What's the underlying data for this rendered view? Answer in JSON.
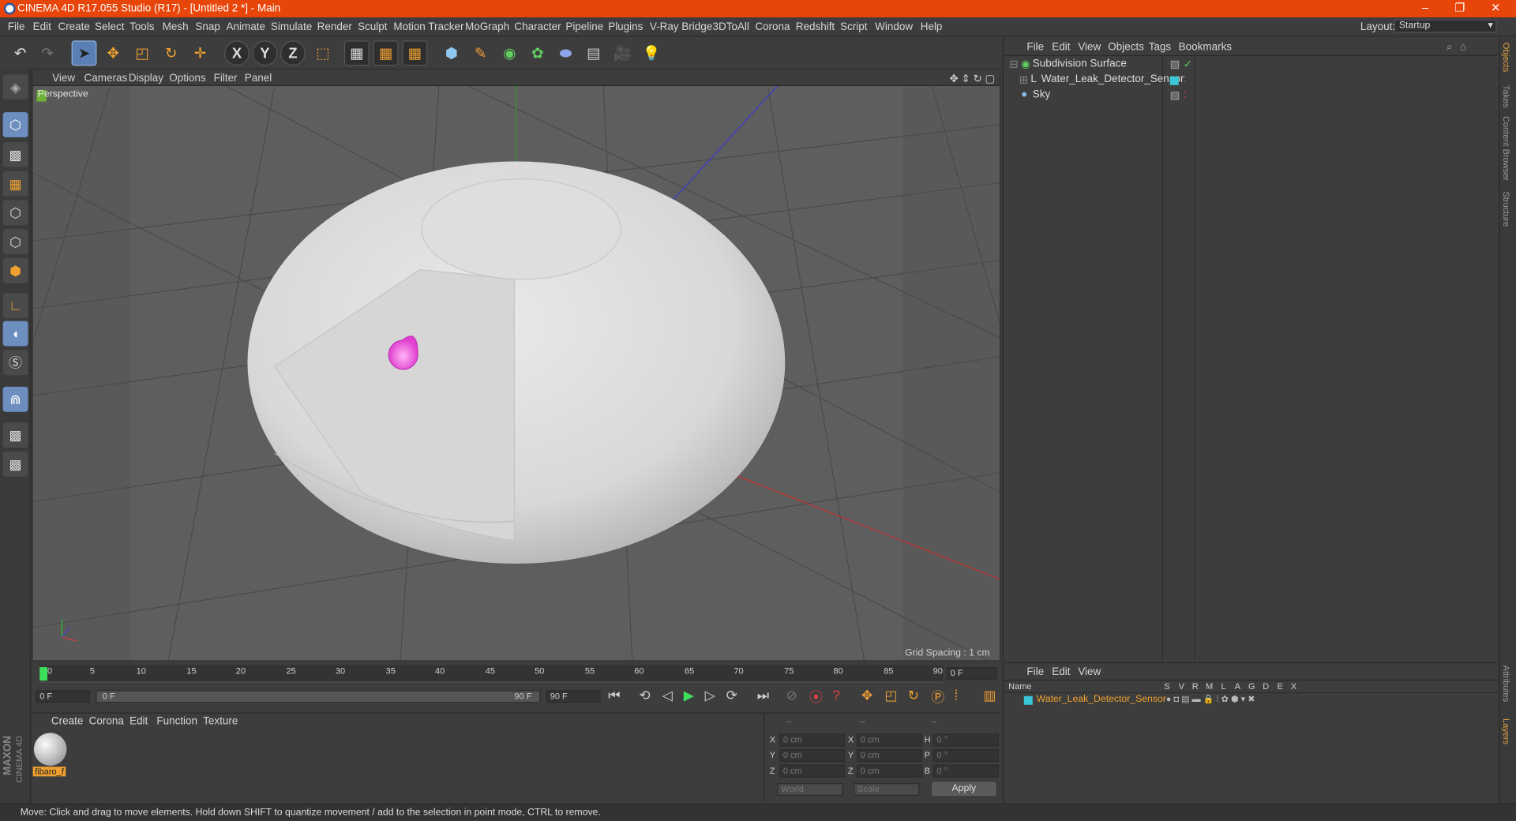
{
  "window": {
    "title": "CINEMA 4D R17.055 Studio (R17) - [Untitled 2 *] - Main",
    "controls": [
      "–",
      "❐",
      "✕"
    ]
  },
  "menubar": {
    "items": [
      "File",
      "Edit",
      "Create",
      "Select",
      "Tools",
      "Mesh",
      "Snap",
      "Animate",
      "Simulate",
      "Render",
      "Sculpt",
      "Motion Tracker",
      "MoGraph",
      "Character",
      "Pipeline",
      "Plugins",
      "V-Ray Bridge",
      "3DToAll",
      "Corona",
      "Redshift",
      "Script",
      "Window",
      "Help"
    ],
    "layout_label": "Layout:",
    "layout_value": "Startup"
  },
  "toolbar": {
    "axes": [
      "X",
      "Y",
      "Z"
    ]
  },
  "viewport": {
    "menu": [
      "View",
      "Cameras",
      "Display",
      "Options",
      "Filter",
      "Panel"
    ],
    "camera_label": "Perspective",
    "grid_spacing": "Grid Spacing : 1 cm"
  },
  "objects_panel": {
    "menu": [
      "File",
      "Edit",
      "View",
      "Objects",
      "Tags",
      "Bookmarks"
    ],
    "items": [
      {
        "name": "Subdivision Surface",
        "indent": 0
      },
      {
        "name": "Water_Leak_Detector_Sensor",
        "indent": 1
      },
      {
        "name": "Sky",
        "indent": 0
      }
    ]
  },
  "side_tabs": [
    "Objects",
    "Takes",
    "Content Browser",
    "Structure",
    "Attributes",
    "Layers"
  ],
  "timeline": {
    "ticks": [
      "0",
      "5",
      "10",
      "15",
      "20",
      "25",
      "30",
      "35",
      "40",
      "45",
      "50",
      "55",
      "60",
      "65",
      "70",
      "75",
      "80",
      "85",
      "90"
    ],
    "current_frame": "0 F",
    "start_field": "0 F",
    "range_start": "0 F",
    "range_end": "90 F",
    "end_field": "90 F"
  },
  "materials": {
    "menu": [
      "Create",
      "Corona",
      "Edit",
      "Function",
      "Texture"
    ],
    "material_name": "fibaro_f"
  },
  "coordinates": {
    "header": [
      "--",
      "--",
      "--"
    ],
    "rows": [
      {
        "a": "X",
        "a_val": "0 cm",
        "b": "X",
        "b_val": "0 cm",
        "c": "H",
        "c_val": "0 °"
      },
      {
        "a": "Y",
        "a_val": "0 cm",
        "b": "Y",
        "b_val": "0 cm",
        "c": "P",
        "c_val": "0 °"
      },
      {
        "a": "Z",
        "a_val": "0 cm",
        "b": "Z",
        "b_val": "0 cm",
        "c": "B",
        "c_val": "0 °"
      }
    ],
    "mode": "World",
    "transform": "Scale",
    "apply": "Apply"
  },
  "layers_panel": {
    "menu": [
      "File",
      "Edit",
      "View"
    ],
    "columns": [
      "Name",
      "S",
      "V",
      "R",
      "M",
      "L",
      "A",
      "G",
      "D",
      "E",
      "X"
    ],
    "row": "Water_Leak_Detector_Sensor"
  },
  "branding": {
    "maxon": "MAXON",
    "product": "CINEMA 4D"
  },
  "status": "Move: Click and drag to move elements. Hold down SHIFT to quantize movement / add to the selection in point mode, CTRL to remove.",
  "colors": {
    "titlebar": "#e8450a",
    "accent": "#f0a030",
    "layer": "#3ac7d8"
  }
}
